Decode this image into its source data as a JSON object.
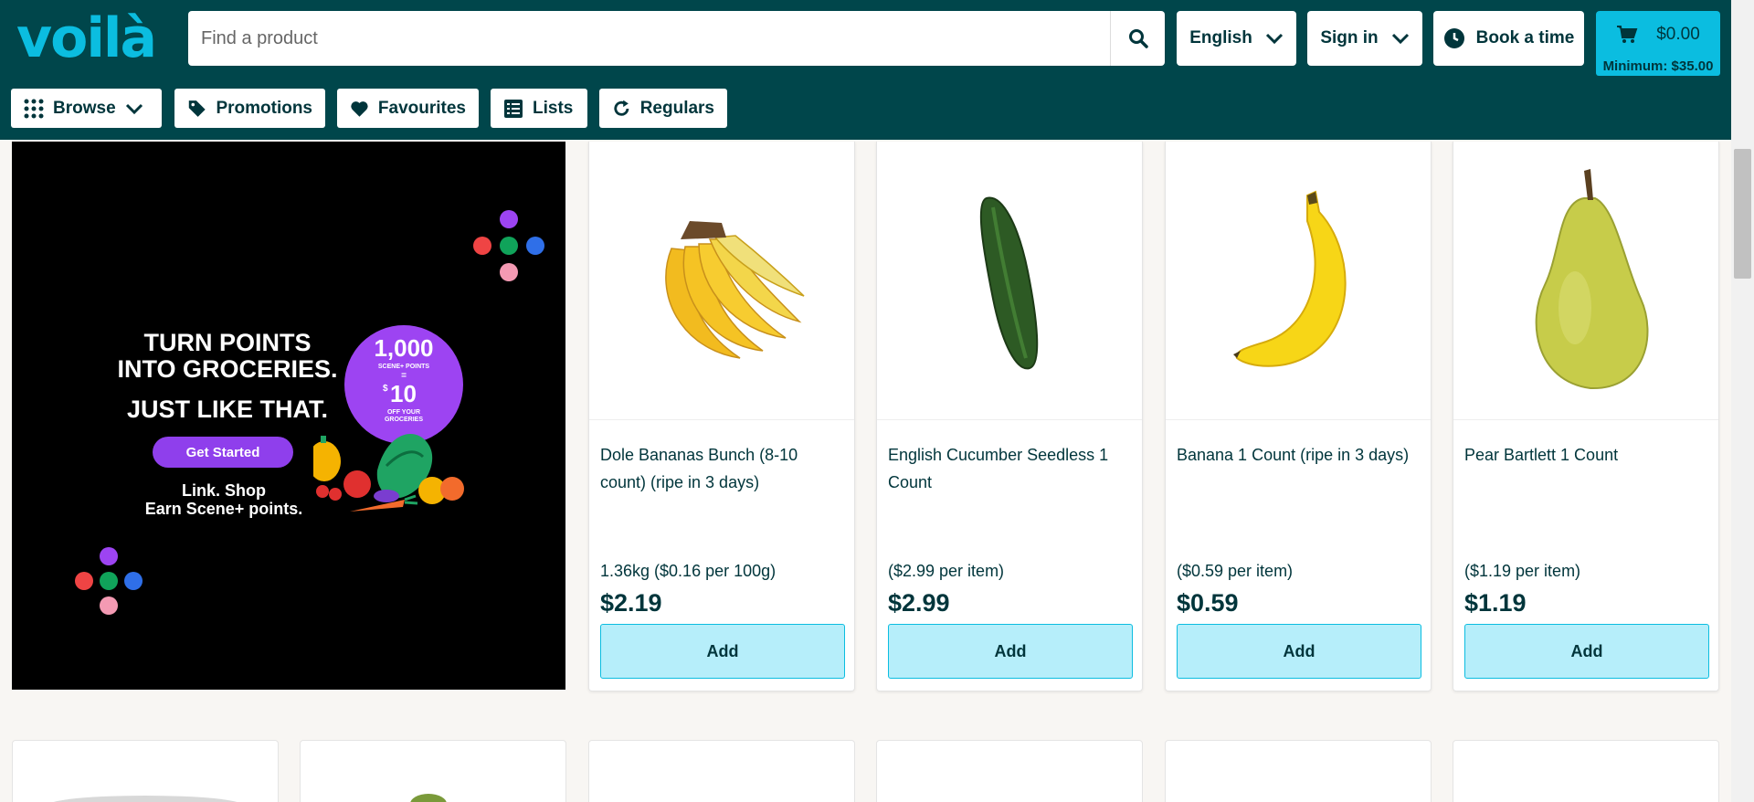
{
  "brand": {
    "logo": "voilà",
    "accent": "#0bbde0",
    "header_bg": "#00464b"
  },
  "search": {
    "placeholder": "Find a product",
    "icon": "search-icon"
  },
  "header": {
    "language": "English",
    "signin": "Sign in",
    "book": "Book a time",
    "cart_total": "$0.00",
    "minimum": "Minimum: $35.00"
  },
  "nav": {
    "browse": "Browse",
    "promotions": "Promotions",
    "favourites": "Favourites",
    "lists": "Lists",
    "regulars": "Regulars"
  },
  "banner": {
    "line1": "TURN POINTS",
    "line2": "INTO GROCERIES.",
    "line3": "JUST LIKE THAT.",
    "cta": "Get Started",
    "footer1": "Link. Shop",
    "footer2": "Earn Scene+ points.",
    "badge_points": "1,000",
    "badge_scene": "SCENE+ POINTS",
    "badge_eq": "=",
    "badge_dollar": "$",
    "badge_value": "10",
    "badge_off1": "OFF YOUR",
    "badge_off2": "GROCERIES"
  },
  "products": [
    {
      "name": "Dole Bananas Bunch (8-10 count) (ripe in 3 days)",
      "unit": "1.36kg ($0.16 per 100g)",
      "price": "$2.19",
      "add": "Add",
      "image": "banana-bunch"
    },
    {
      "name": "English Cucumber Seedless 1 Count",
      "unit": "($2.99 per item)",
      "price": "$2.99",
      "add": "Add",
      "image": "cucumber"
    },
    {
      "name": "Banana 1 Count (ripe in 3 days)",
      "unit": "($0.59 per item)",
      "price": "$0.59",
      "add": "Add",
      "image": "banana"
    },
    {
      "name": "Pear Bartlett 1 Count",
      "unit": "($1.19 per item)",
      "price": "$1.19",
      "add": "Add",
      "image": "pear"
    }
  ]
}
